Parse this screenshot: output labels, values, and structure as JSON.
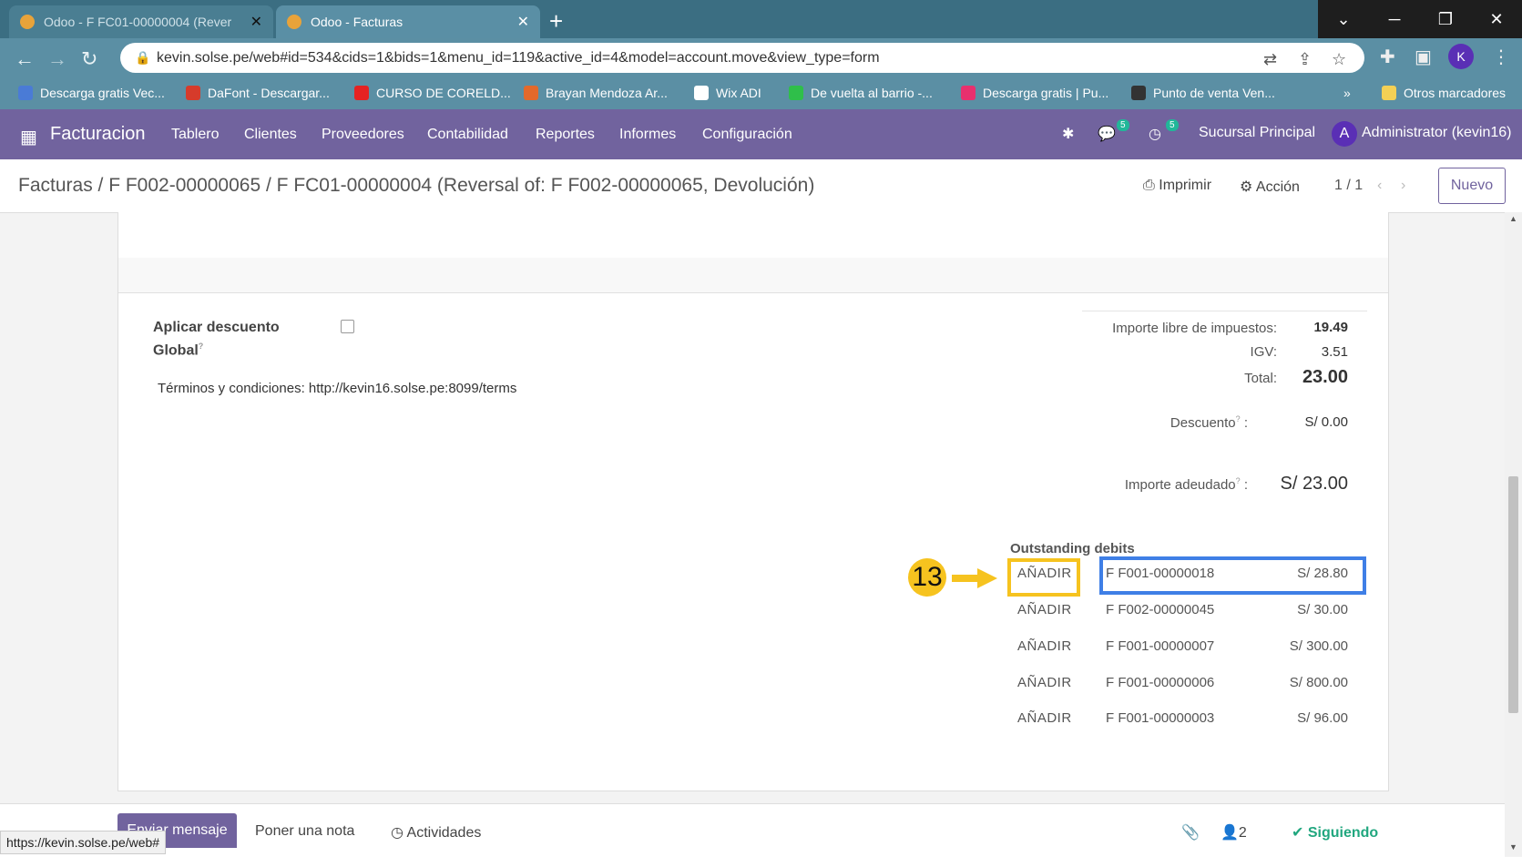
{
  "browser": {
    "tabs": [
      {
        "title": "Odoo - F FC01-00000004 (Rever",
        "close": "✕"
      },
      {
        "title": "Odoo - Facturas",
        "close": "✕"
      }
    ],
    "new_tab": "+",
    "url": "kevin.solse.pe/web#id=534&cids=1&bids=1&menu_id=119&active_id=4&model=account.move&view_type=form",
    "profile_initial": "K",
    "bookmarks": [
      {
        "label": "Descarga gratis Vec...",
        "color": "#4a7bd6"
      },
      {
        "label": "DaFont - Descargar...",
        "color": "#d63b2b"
      },
      {
        "label": "CURSO DE CORELD...",
        "color": "#e52222"
      },
      {
        "label": "Brayan Mendoza Ar...",
        "color": "#e3692b"
      },
      {
        "label": "Wix ADI",
        "color": "#ffffff"
      },
      {
        "label": "De vuelta al barrio -...",
        "color": "#2fbf4a"
      },
      {
        "label": "Descarga gratis | Pu...",
        "color": "#e8306e"
      },
      {
        "label": "Punto de venta Ven...",
        "color": "#333333"
      }
    ],
    "more_bookmarks": "»",
    "other_bookmarks": "Otros marcadores",
    "status_url": "https://kevin.solse.pe/web#"
  },
  "odoo_nav": {
    "app_name": "Facturacion",
    "menus": [
      "Tablero",
      "Clientes",
      "Proveedores",
      "Contabilidad",
      "Reportes",
      "Informes",
      "Configuración"
    ],
    "messages_count": "5",
    "activities_count": "5",
    "branch": "Sucursal Principal",
    "user_initial": "A",
    "user": "Administrator (kevin16)"
  },
  "control_panel": {
    "breadcrumb": "Facturas / F F002-00000065 / F FC01-00000004 (Reversal of: F F002-00000065, Devolución)",
    "print": "Imprimir",
    "action": "Acción",
    "pager": "1 / 1",
    "new": "Nuevo"
  },
  "form": {
    "discount_label_1": "Aplicar descuento",
    "discount_label_2": "Global",
    "help_mark": "?",
    "terms": "Términos y condiciones: http://kevin16.solse.pe:8099/terms",
    "totals": {
      "untaxed_label": "Importe libre de impuestos:",
      "untaxed_value": "19.49",
      "igv_label": "IGV:",
      "igv_value": "3.51",
      "total_label": "Total:",
      "total_value": "23.00",
      "discount_label": "Descuento",
      "discount_value": "S/ 0.00",
      "due_label": "Importe adeudado",
      "due_value": "S/ 23.00"
    },
    "outstanding_title": "Outstanding debits",
    "outstanding": [
      {
        "add": "AÑADIR",
        "ref": "F F001-00000018",
        "amount": "S/ 28.80"
      },
      {
        "add": "AÑADIR",
        "ref": "F F002-00000045",
        "amount": "S/ 30.00"
      },
      {
        "add": "AÑADIR",
        "ref": "F F001-00000007",
        "amount": "S/ 300.00"
      },
      {
        "add": "AÑADIR",
        "ref": "F F001-00000006",
        "amount": "S/ 800.00"
      },
      {
        "add": "AÑADIR",
        "ref": "F F001-00000003",
        "amount": "S/ 96.00"
      }
    ],
    "step_number": "13"
  },
  "chatter": {
    "send": "Enviar mensaje",
    "note": "Poner una nota",
    "activities": "Actividades",
    "followers": "2",
    "following": "Siguiendo"
  }
}
